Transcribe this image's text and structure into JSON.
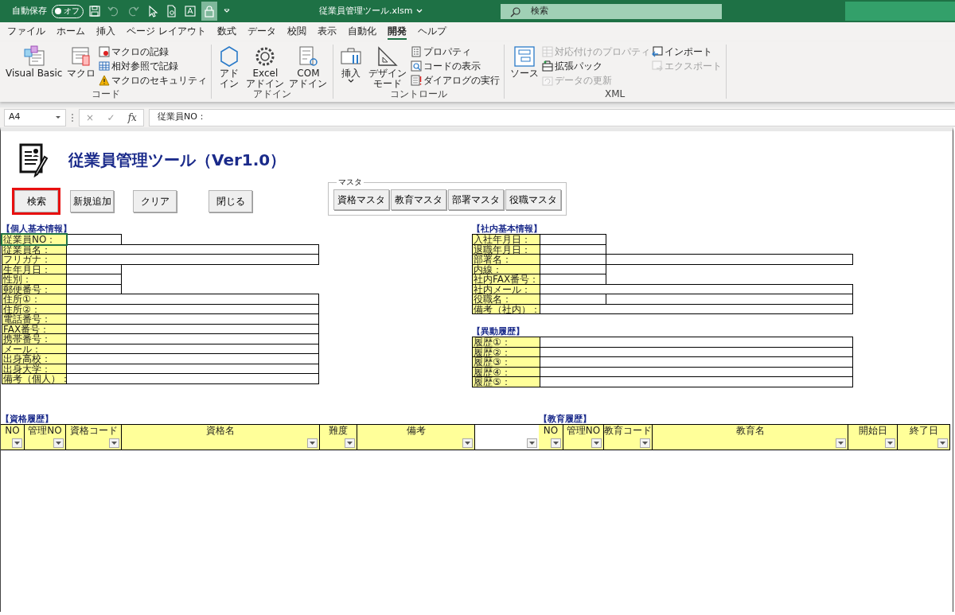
{
  "title_bar": {
    "autosave": {
      "label": "自動保存",
      "toggle_text": "オフ",
      "on": false
    },
    "quick_access": [
      {
        "disabled": false,
        "on": false
      },
      {
        "disabled": true,
        "on": false
      },
      {
        "disabled": true,
        "on": false
      },
      {
        "disabled": false,
        "on": false
      },
      {
        "disabled": false,
        "on": false
      },
      {
        "disabled": false,
        "on": false
      },
      {
        "disabled": false,
        "on": true
      }
    ],
    "file_name": "従業員管理ツール.xlsm",
    "search": {
      "placeholder": "検索"
    }
  },
  "ribbon_tabs": [
    {
      "label": "ファイル",
      "selected": false
    },
    {
      "label": "ホーム",
      "selected": false
    },
    {
      "label": "挿入",
      "selected": false
    },
    {
      "label": "ページ レイアウト",
      "selected": false
    },
    {
      "label": "数式",
      "selected": false
    },
    {
      "label": "データ",
      "selected": false
    },
    {
      "label": "校閲",
      "selected": false
    },
    {
      "label": "表示",
      "selected": false
    },
    {
      "label": "自動化",
      "selected": false
    },
    {
      "label": "開発",
      "selected": true
    },
    {
      "label": "ヘルプ",
      "selected": false
    }
  ],
  "ribbon_groups": [
    {
      "label": "コード",
      "items": [
        {
          "kind": "large",
          "label": "Visual Basic",
          "disabled": false
        },
        {
          "kind": "large",
          "label": "マクロ",
          "disabled": false
        },
        {
          "kind": "stack",
          "items": [
            {
              "label": "マクロの記録",
              "disabled": false
            },
            {
              "label": "相対参照で記録",
              "disabled": false
            },
            {
              "label": "マクロのセキュリティ",
              "disabled": false
            }
          ]
        }
      ]
    },
    {
      "label": "アドイン",
      "items": [
        {
          "kind": "large",
          "label": "アドイン",
          "disabled": false
        },
        {
          "kind": "large",
          "label": "Excel\nアドイン",
          "disabled": false
        },
        {
          "kind": "large",
          "label": "COM\nアドイン",
          "disabled": false
        }
      ]
    },
    {
      "label": "コントロール",
      "items": [
        {
          "kind": "large",
          "label": "挿入",
          "disabled": false
        },
        {
          "kind": "large",
          "label": "デザインモード",
          "disabled": false
        },
        {
          "kind": "stack",
          "items": [
            {
              "label": "プロパティ",
              "disabled": false
            },
            {
              "label": "コードの表示",
              "disabled": false
            },
            {
              "label": "ダイアログの実行",
              "disabled": false
            }
          ]
        }
      ]
    },
    {
      "label": "XML",
      "items": [
        {
          "kind": "large",
          "label": "ソース",
          "disabled": false
        },
        {
          "kind": "stack",
          "items": [
            {
              "label": "対応付けのプロパティ",
              "disabled": true
            },
            {
              "label": "拡張パック",
              "disabled": false
            },
            {
              "label": "データの更新",
              "disabled": true
            }
          ]
        },
        {
          "kind": "stack",
          "items": [
            {
              "label": "インポート",
              "disabled": false
            },
            {
              "label": "エクスポート",
              "disabled": true
            }
          ]
        }
      ]
    }
  ],
  "formula_bar": {
    "name_box": "A4",
    "cancel": "×",
    "enter": "✓",
    "function": "fx",
    "formula": "従業員NO："
  },
  "sheet": {
    "title": "従業員管理ツール（Ver1.0）",
    "buttons": [
      {
        "label": "検索",
        "highlighted": true
      },
      {
        "label": "新規追加",
        "highlighted": false
      },
      {
        "label": "クリア",
        "highlighted": false
      },
      {
        "label": "閉じる",
        "highlighted": false
      }
    ],
    "master_group": {
      "label": "マスタ",
      "buttons": [
        "資格マスタ",
        "教育マスタ",
        "部署マスタ",
        "役職マスタ"
      ]
    },
    "personal_info": {
      "heading": "【個人基本情報】",
      "rows": [
        {
          "label": "従業員NO：",
          "kind": "short",
          "selected": true
        },
        {
          "label": "従業員名：",
          "kind": "long",
          "selected": false
        },
        {
          "label": "フリガナ：",
          "kind": "long",
          "selected": false
        },
        {
          "label": "生年月日：",
          "kind": "short",
          "selected": false
        },
        {
          "label": "性別：",
          "kind": "short",
          "selected": false
        },
        {
          "label": "郵便番号：",
          "kind": "short",
          "selected": false
        },
        {
          "label": "住所①：",
          "kind": "long",
          "selected": false
        },
        {
          "label": "住所②：",
          "kind": "long",
          "selected": false
        },
        {
          "label": "電話番号：",
          "kind": "long",
          "selected": false
        },
        {
          "label": "FAX番号：",
          "kind": "long",
          "selected": false
        },
        {
          "label": "携帯番号：",
          "kind": "long",
          "selected": false
        },
        {
          "label": "メール：",
          "kind": "long",
          "selected": false
        },
        {
          "label": "出身高校：",
          "kind": "long",
          "selected": false
        },
        {
          "label": "出身大学：",
          "kind": "long",
          "selected": false
        },
        {
          "label": "備考（個人）：",
          "kind": "long",
          "selected": false
        }
      ]
    },
    "company_info": {
      "heading": "【社内基本情報】",
      "rows": [
        {
          "label": "入社年月日：",
          "kind": "short"
        },
        {
          "label": "退職年月日：",
          "kind": "short"
        },
        {
          "label": "部署名：",
          "kind": "split"
        },
        {
          "label": "内線：",
          "kind": "short"
        },
        {
          "label": "社内FAX番号：",
          "kind": "short"
        },
        {
          "label": "社内メール：",
          "kind": "long"
        },
        {
          "label": "役職名：",
          "kind": "split"
        },
        {
          "label": "備考（社内）：",
          "kind": "long"
        }
      ]
    },
    "transfer_history": {
      "heading": "【異動履歴】",
      "rows": [
        {
          "label": "履歴①：",
          "kind": "long"
        },
        {
          "label": "履歴②：",
          "kind": "long"
        },
        {
          "label": "履歴③：",
          "kind": "long"
        },
        {
          "label": "履歴④：",
          "kind": "long"
        },
        {
          "label": "履歴⑤：",
          "kind": "long"
        }
      ]
    },
    "qualification_history": {
      "heading": "【資格履歴】",
      "columns": [
        {
          "kind": "header",
          "label": "NO"
        },
        {
          "kind": "header",
          "label": "管理NO"
        },
        {
          "kind": "header",
          "label": "資格コード"
        },
        {
          "kind": "header",
          "label": "資格名"
        },
        {
          "kind": "header",
          "label": "難度"
        },
        {
          "kind": "header",
          "label": "備考"
        },
        {
          "kind": "blank"
        }
      ]
    },
    "education_history": {
      "heading": "【教育履歴】",
      "columns": [
        {
          "kind": "header",
          "label": "NO"
        },
        {
          "kind": "header",
          "label": "管理NO"
        },
        {
          "kind": "header",
          "label": "教育コード"
        },
        {
          "kind": "header",
          "label": "教育名"
        },
        {
          "kind": "header",
          "label": "開始日"
        },
        {
          "kind": "header",
          "label": "終了日"
        }
      ]
    }
  }
}
